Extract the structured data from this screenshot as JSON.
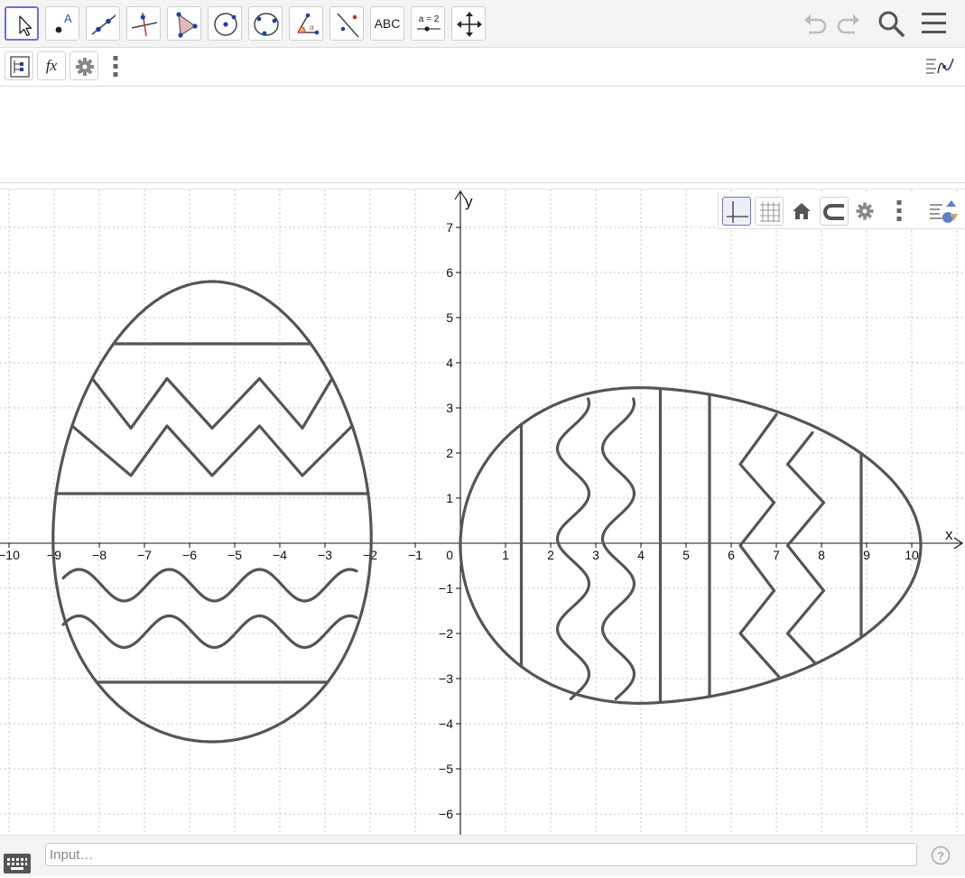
{
  "toolbar": {
    "tools": [
      {
        "name": "move-tool",
        "icon": "cursor-arrow-icon"
      },
      {
        "name": "point-tool",
        "icon": "point-icon"
      },
      {
        "name": "line-tool",
        "icon": "line-through-points-icon"
      },
      {
        "name": "perpendicular-line-tool",
        "icon": "perpendicular-line-icon"
      },
      {
        "name": "polygon-tool",
        "icon": "polygon-icon"
      },
      {
        "name": "circle-tool",
        "icon": "circle-center-point-icon"
      },
      {
        "name": "conic-tool",
        "icon": "conic-through-points-icon"
      },
      {
        "name": "angle-tool",
        "icon": "angle-icon"
      },
      {
        "name": "reflect-tool",
        "icon": "reflect-about-line-icon"
      },
      {
        "name": "text-tool",
        "icon": "text-icon",
        "label": "ABC"
      },
      {
        "name": "slider-tool",
        "icon": "slider-icon",
        "label": "a = 2"
      },
      {
        "name": "move-graphics-view-tool",
        "icon": "move-view-icon"
      }
    ],
    "active_tool": "move-tool",
    "right_icons": [
      "undo-icon",
      "redo-icon",
      "search-icon",
      "menu-icon"
    ]
  },
  "algebra_bar": {
    "icons": [
      "algebra-view-icon",
      "fx-input-icon",
      "gear-icon",
      "more-vertical-icon"
    ],
    "fx_label": "fx",
    "right_icon": "algebra-style-icon"
  },
  "graphics_style_bar": {
    "icons": [
      "show-axes-icon",
      "show-grid-icon",
      "home-icon",
      "point-capture-icon",
      "gear-icon",
      "more-vertical-icon",
      "style-bar-toggle-icon"
    ]
  },
  "input_bar": {
    "placeholder": "Input…",
    "keyboard_icon": "keyboard-icon",
    "help_icon": "help-icon",
    "help_label": "?"
  },
  "graph": {
    "x_axis_label": "x",
    "y_axis_label": "y",
    "x_tick_labels": [
      "−10",
      "−9",
      "−8",
      "−7",
      "−6",
      "−5",
      "−4",
      "−3",
      "−2",
      "−1",
      "1",
      "2",
      "3",
      "4",
      "5",
      "6",
      "7",
      "8",
      "9",
      "10"
    ],
    "y_tick_labels": [
      "7",
      "6",
      "5",
      "4",
      "3",
      "2",
      "1",
      "−1",
      "−2",
      "−3",
      "−4",
      "−5",
      "−6"
    ],
    "origin_label": "0",
    "x_range": [
      -10.2,
      11.1
    ],
    "y_range": [
      -6.5,
      7.8
    ],
    "grid": true,
    "grid_style": "dotted",
    "curve_color": "#555555",
    "egg_1_vertical": {
      "center": [
        -5.5,
        0.7
      ],
      "half_width": 3.5,
      "top": 5.8,
      "bottom": -4.4,
      "decorations": [
        "horizontal line y=4.4",
        "zigzag",
        "zigzag",
        "horizontal line y=1.1",
        "wave",
        "wave",
        "horizontal line y=-3.1"
      ]
    },
    "egg_2_horizontal": {
      "left": 0,
      "right": 10.2,
      "top": 3.45,
      "bottom": -3.5,
      "decorations": [
        "vertical line x=1.35",
        "wave",
        "wave",
        "vertical line x=4.4",
        "vertical line x=5.5",
        "zigzag",
        "zigzag",
        "vertical line x=8.9"
      ]
    }
  }
}
